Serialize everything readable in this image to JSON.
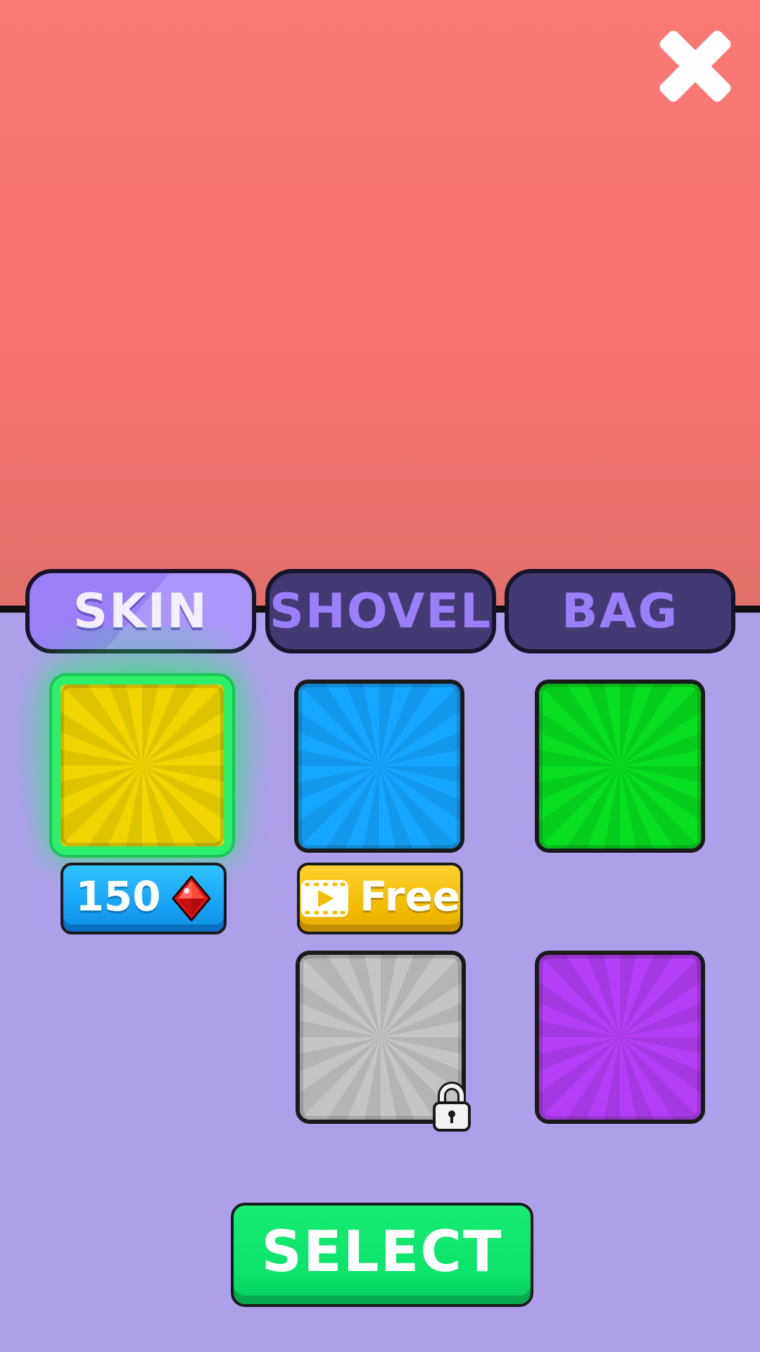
{
  "tabs": [
    {
      "label": "SKIN",
      "active": true
    },
    {
      "label": "SHOVEL",
      "active": false
    },
    {
      "label": "BAG",
      "active": false
    }
  ],
  "items": [
    {
      "name": "yellow",
      "color": "#f0d500",
      "state": "selected",
      "price": {
        "type": "gems",
        "label": "150",
        "icon": "red-gem-icon"
      }
    },
    {
      "name": "blue",
      "color": "#15a7ff",
      "state": "available",
      "price": {
        "type": "ad",
        "label": "Free",
        "icon": "video-play-icon"
      }
    },
    {
      "name": "green",
      "color": "#07de1f",
      "state": "owned"
    },
    {
      "name": "gray",
      "color": "#c4c4c4",
      "state": "locked",
      "icon": "lock-icon"
    },
    {
      "name": "purple",
      "color": "#b43ef5",
      "state": "owned"
    }
  ],
  "select_button": {
    "label": "SELECT"
  },
  "colors": {
    "preview_bg": "#f57772",
    "panel_bg": "#ae9fea",
    "tab_active": "#9b7ff8",
    "tab_inactive": "#433a73",
    "selection_glow": "#2df06a",
    "select_button": "#0be36b"
  }
}
